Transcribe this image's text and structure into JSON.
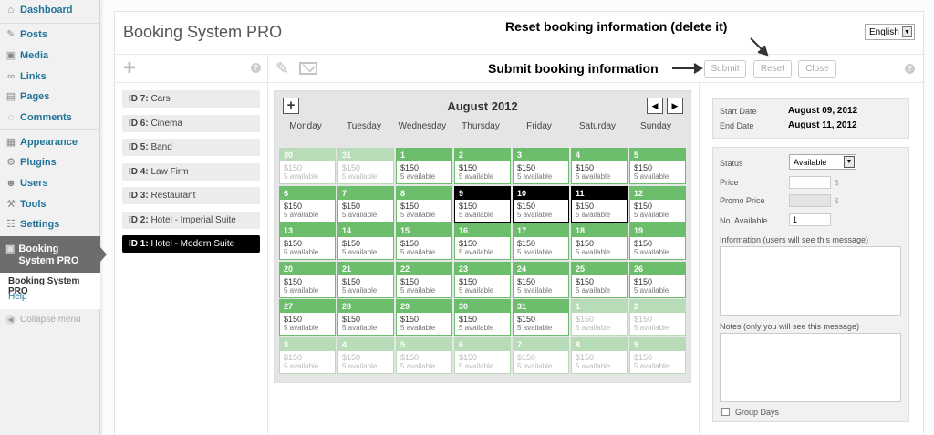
{
  "wp_menu": {
    "items": [
      {
        "label": "Dashboard",
        "icon": "dashboard-icon"
      },
      {
        "label": "Posts",
        "icon": "pin-icon"
      },
      {
        "label": "Media",
        "icon": "media-icon"
      },
      {
        "label": "Links",
        "icon": "link-icon"
      },
      {
        "label": "Pages",
        "icon": "page-icon"
      },
      {
        "label": "Comments",
        "icon": "comment-icon"
      },
      {
        "label": "Appearance",
        "icon": "appearance-icon"
      },
      {
        "label": "Plugins",
        "icon": "plugin-icon"
      },
      {
        "label": "Users",
        "icon": "users-icon"
      },
      {
        "label": "Tools",
        "icon": "tools-icon"
      },
      {
        "label": "Settings",
        "icon": "settings-icon"
      }
    ],
    "active": {
      "label": "Booking System PRO",
      "icon": "booking-icon"
    },
    "submenu": [
      "Booking System PRO",
      "Help"
    ],
    "collapse": "Collapse menu"
  },
  "header": {
    "title": "Booking System PRO",
    "language": "English"
  },
  "toolbar": {
    "submit": "Submit",
    "reset": "Reset",
    "close": "Close"
  },
  "annotations": {
    "reset": "Reset booking information (delete it)",
    "submit": "Submit booking information"
  },
  "calendars": [
    {
      "id": "ID 7:",
      "name": "Cars"
    },
    {
      "id": "ID 6:",
      "name": "Cinema"
    },
    {
      "id": "ID 5:",
      "name": "Band"
    },
    {
      "id": "ID 4:",
      "name": "Law Firm"
    },
    {
      "id": "ID 3:",
      "name": "Restaurant"
    },
    {
      "id": "ID 2:",
      "name": "Hotel - Imperial Suite"
    },
    {
      "id": "ID 1:",
      "name": "Hotel - Modern Suite"
    }
  ],
  "calendar": {
    "month": "August 2012",
    "prev": "◀",
    "next": "▶",
    "weekdays": [
      "Monday",
      "Tuesday",
      "Wednesday",
      "Thursday",
      "Friday",
      "Saturday",
      "Sunday"
    ],
    "price": "$150",
    "available": "5 available",
    "days": [
      [
        "30",
        "faded"
      ],
      [
        "31",
        "faded"
      ],
      [
        "1",
        ""
      ],
      [
        "2",
        ""
      ],
      [
        "3",
        ""
      ],
      [
        "4",
        ""
      ],
      [
        "5",
        ""
      ],
      [
        "6",
        ""
      ],
      [
        "7",
        ""
      ],
      [
        "8",
        ""
      ],
      [
        "9",
        "sel"
      ],
      [
        "10",
        "sel"
      ],
      [
        "11",
        "sel"
      ],
      [
        "12",
        ""
      ],
      [
        "13",
        ""
      ],
      [
        "14",
        ""
      ],
      [
        "15",
        ""
      ],
      [
        "16",
        ""
      ],
      [
        "17",
        ""
      ],
      [
        "18",
        ""
      ],
      [
        "19",
        ""
      ],
      [
        "20",
        ""
      ],
      [
        "21",
        ""
      ],
      [
        "22",
        ""
      ],
      [
        "23",
        ""
      ],
      [
        "24",
        ""
      ],
      [
        "25",
        ""
      ],
      [
        "26",
        ""
      ],
      [
        "27",
        ""
      ],
      [
        "28",
        ""
      ],
      [
        "29",
        ""
      ],
      [
        "30",
        ""
      ],
      [
        "31",
        ""
      ],
      [
        "1",
        "faded"
      ],
      [
        "2",
        "faded"
      ],
      [
        "3",
        "faded"
      ],
      [
        "4",
        "faded"
      ],
      [
        "5",
        "faded"
      ],
      [
        "6",
        "faded"
      ],
      [
        "7",
        "faded"
      ],
      [
        "8",
        "faded"
      ],
      [
        "9",
        "faded"
      ]
    ]
  },
  "form": {
    "start_label": "Start Date",
    "start_value": "August 09, 2012",
    "end_label": "End Date",
    "end_value": "August 11, 2012",
    "status_label": "Status",
    "status_value": "Available",
    "price_label": "Price",
    "promo_label": "Promo Price",
    "currency": "$",
    "available_label": "No. Available",
    "available_value": "1",
    "info_label": "Information (users will see this message)",
    "notes_label": "Notes (only you will see this message)",
    "group_label": "Group Days"
  }
}
